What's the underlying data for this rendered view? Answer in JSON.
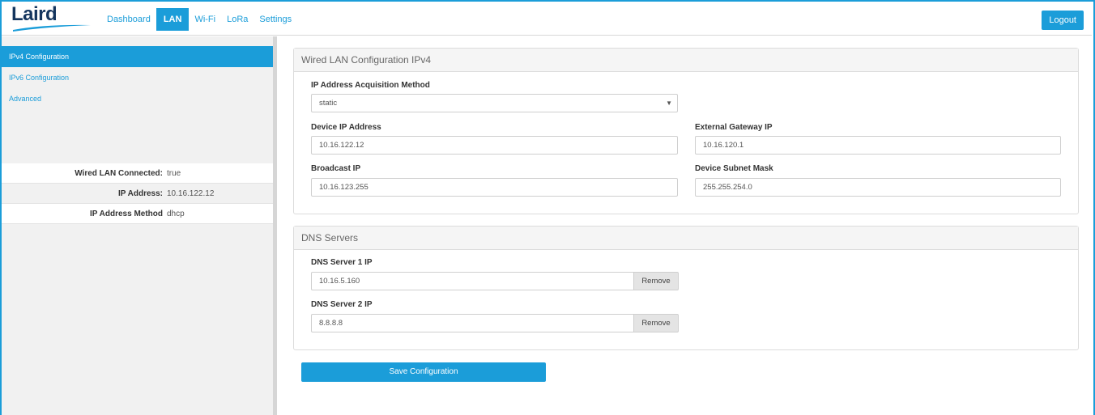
{
  "brand": {
    "logo_text": "Laird",
    "accent": "#1b9dd9",
    "logo_color": "#14355e"
  },
  "nav": {
    "items": [
      {
        "label": "Dashboard"
      },
      {
        "label": "LAN"
      },
      {
        "label": "Wi-Fi"
      },
      {
        "label": "LoRa"
      },
      {
        "label": "Settings"
      }
    ],
    "active": "LAN",
    "logout_label": "Logout"
  },
  "sidebar": {
    "items": [
      {
        "label": "IPv4 Configuration"
      },
      {
        "label": "IPv6 Configuration"
      },
      {
        "label": "Advanced"
      }
    ],
    "status": [
      {
        "label": "Wired LAN Connected:",
        "value": "true"
      },
      {
        "label": "IP Address:",
        "value": "10.16.122.12"
      },
      {
        "label": "IP Address Method",
        "value": "dhcp"
      }
    ]
  },
  "wired": {
    "title": "Wired LAN Configuration IPv4",
    "method_label": "IP Address Acquisition Method",
    "method_value": "static",
    "device_ip_label": "Device IP Address",
    "device_ip_value": "10.16.122.12",
    "gateway_label": "External Gateway IP",
    "gateway_value": "10.16.120.1",
    "broadcast_label": "Broadcast IP",
    "broadcast_value": "10.16.123.255",
    "mask_label": "Device Subnet Mask",
    "mask_value": "255.255.254.0"
  },
  "dns": {
    "title": "DNS Servers",
    "server1_label": "DNS Server 1 IP",
    "server1_value": "10.16.5.160",
    "server2_label": "DNS Server 2 IP",
    "server2_value": "8.8.8.8",
    "remove_label": "Remove"
  },
  "save_label": "Save Configuration"
}
